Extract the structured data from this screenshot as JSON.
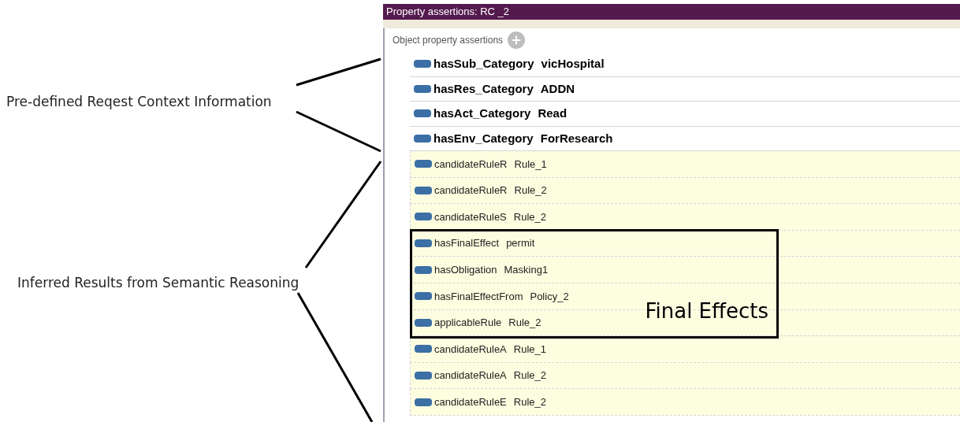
{
  "annotations": {
    "context_label": "Pre-defined Reqest Context Information",
    "inferred_label": "Inferred Results from Semantic Reasoning",
    "highlight_label": "Final Effects"
  },
  "panel": {
    "title": "Property assertions: RC _2",
    "section_label": "Object property assertions",
    "assertions": [
      {
        "kind": "asserted",
        "property": "hasSub_Category",
        "value": "vicHospital"
      },
      {
        "kind": "asserted",
        "property": "hasRes_Category",
        "value": "ADDN"
      },
      {
        "kind": "asserted",
        "property": "hasAct_Category",
        "value": "Read"
      },
      {
        "kind": "asserted",
        "property": "hasEnv_Category",
        "value": "ForResearch"
      },
      {
        "kind": "inferred",
        "property": "candidateRuleR",
        "value": "Rule_1"
      },
      {
        "kind": "inferred",
        "property": "candidateRuleR",
        "value": "Rule_2"
      },
      {
        "kind": "inferred",
        "property": "candidateRuleS",
        "value": "Rule_2"
      },
      {
        "kind": "inferred",
        "property": "hasFinalEffect",
        "value": "permit"
      },
      {
        "kind": "inferred",
        "property": "hasObligation",
        "value": "Masking1"
      },
      {
        "kind": "inferred",
        "property": "hasFinalEffectFrom",
        "value": "Policy_2"
      },
      {
        "kind": "inferred",
        "property": "applicableRule",
        "value": "Rule_2"
      },
      {
        "kind": "inferred",
        "property": "candidateRuleA",
        "value": "Rule_1"
      },
      {
        "kind": "inferred",
        "property": "candidateRuleA",
        "value": "Rule_2"
      },
      {
        "kind": "inferred",
        "property": "candidateRuleE",
        "value": "Rule_2"
      }
    ]
  }
}
